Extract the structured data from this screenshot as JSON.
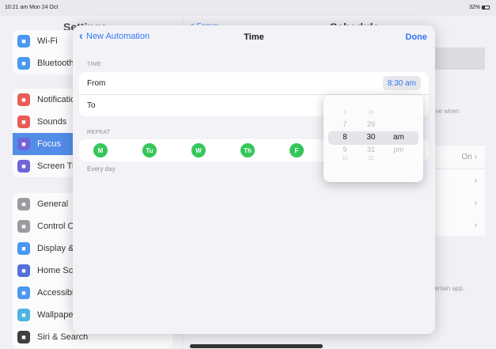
{
  "status_bar": {
    "time": "10:21 am  Mon 24 Oct",
    "battery": "32%"
  },
  "settings_sidebar": {
    "title": "Settings",
    "group1": [
      {
        "label": "Wi-Fi",
        "icon": "wifi-icon",
        "color": "#2f8bf2"
      },
      {
        "label": "Bluetooth",
        "icon": "bluetooth-icon",
        "color": "#2f8bf2"
      }
    ],
    "group2": [
      {
        "label": "Notifications",
        "icon": "notifications-icon",
        "color": "#e9453d"
      },
      {
        "label": "Sounds",
        "icon": "sounds-icon",
        "color": "#e9453d"
      },
      {
        "label": "Focus",
        "icon": "focus-icon",
        "color": "#5a4fd3",
        "selected": true
      },
      {
        "label": "Screen Time",
        "icon": "screen-time-icon",
        "color": "#5a4fd3"
      }
    ],
    "group3": [
      {
        "label": "General",
        "icon": "general-icon",
        "color": "#8e8e93"
      },
      {
        "label": "Control Centre",
        "icon": "control-centre-icon",
        "color": "#8e8e93"
      },
      {
        "label": "Display & Brightness",
        "icon": "display-icon",
        "color": "#2f8bf2"
      },
      {
        "label": "Home Screen & Dock",
        "icon": "home-screen-icon",
        "color": "#3d5bd6"
      },
      {
        "label": "Accessibility",
        "icon": "accessibility-icon",
        "color": "#2f8bf2"
      },
      {
        "label": "Wallpaper",
        "icon": "wallpaper-icon",
        "color": "#34aadc"
      },
      {
        "label": "Siri & Search",
        "icon": "siri-icon",
        "color": "#222222"
      }
    ]
  },
  "detail_pane": {
    "title": "Schedule",
    "back": "< Focus",
    "note1": "ensitive when",
    "on_value": "On",
    "note2": "g a certain app."
  },
  "sheet": {
    "back_label": "New Automation",
    "title": "Time",
    "done_label": "Done",
    "time_section": "TIME",
    "from_label": "From",
    "from_value": "8:30 am",
    "to_label": "To",
    "repeat_section": "REPEAT",
    "days": [
      "M",
      "Tu",
      "W",
      "Th",
      "F"
    ],
    "every_day": "Every day"
  },
  "picker": {
    "hours": [
      "6",
      "7",
      "8",
      "9",
      "10"
    ],
    "minutes": [
      "28",
      "29",
      "30",
      "31",
      "32"
    ],
    "periods": [
      "am",
      "pm"
    ],
    "selected": {
      "hour": "8",
      "minute": "30",
      "period": "am"
    }
  },
  "colors": {
    "accent": "#3478f6",
    "day_green": "#34c759"
  }
}
